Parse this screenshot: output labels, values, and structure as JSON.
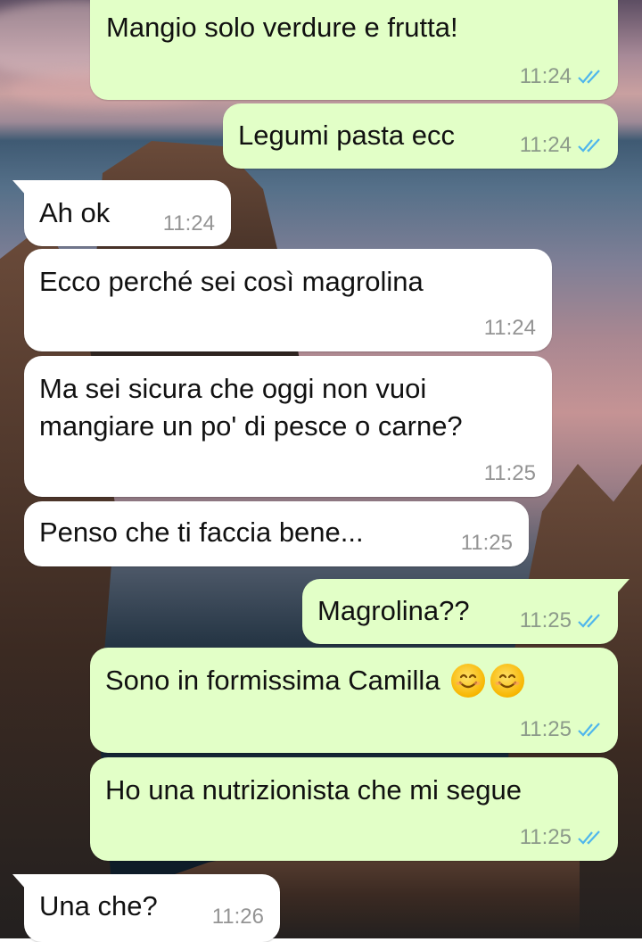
{
  "colors": {
    "outgoing_bubble": "#e2ffc7",
    "incoming_bubble": "#ffffff",
    "read_ticks": "#4fb6ec",
    "time_text": "#8c9a8a"
  },
  "messages": [
    {
      "direction": "out",
      "text": "Mangio solo verdure e frutta!",
      "time": "11:24",
      "status": "read"
    },
    {
      "direction": "out",
      "text": "Legumi pasta ecc",
      "time": "11:24",
      "status": "read"
    },
    {
      "direction": "in",
      "text": "Ah ok",
      "time": "11:24"
    },
    {
      "direction": "in",
      "text": "Ecco perché sei così magrolina",
      "time": "11:24"
    },
    {
      "direction": "in",
      "text": "Ma sei sicura che oggi non vuoi\nmangiare un po' di pesce o carne?",
      "time": "11:25"
    },
    {
      "direction": "in",
      "text": "Penso che ti faccia bene...",
      "time": "11:25"
    },
    {
      "direction": "out",
      "text": "Magrolina??",
      "time": "11:25",
      "status": "read"
    },
    {
      "direction": "out",
      "text": "Sono in formissima Camilla",
      "emoji": [
        "smiling-face-icon",
        "smiling-face-icon"
      ],
      "time": "11:25",
      "status": "read"
    },
    {
      "direction": "out",
      "text": "Ho una nutrizionista che mi segue",
      "time": "11:25",
      "status": "read"
    },
    {
      "direction": "in",
      "text": "Una che?",
      "time": "11:26"
    }
  ]
}
